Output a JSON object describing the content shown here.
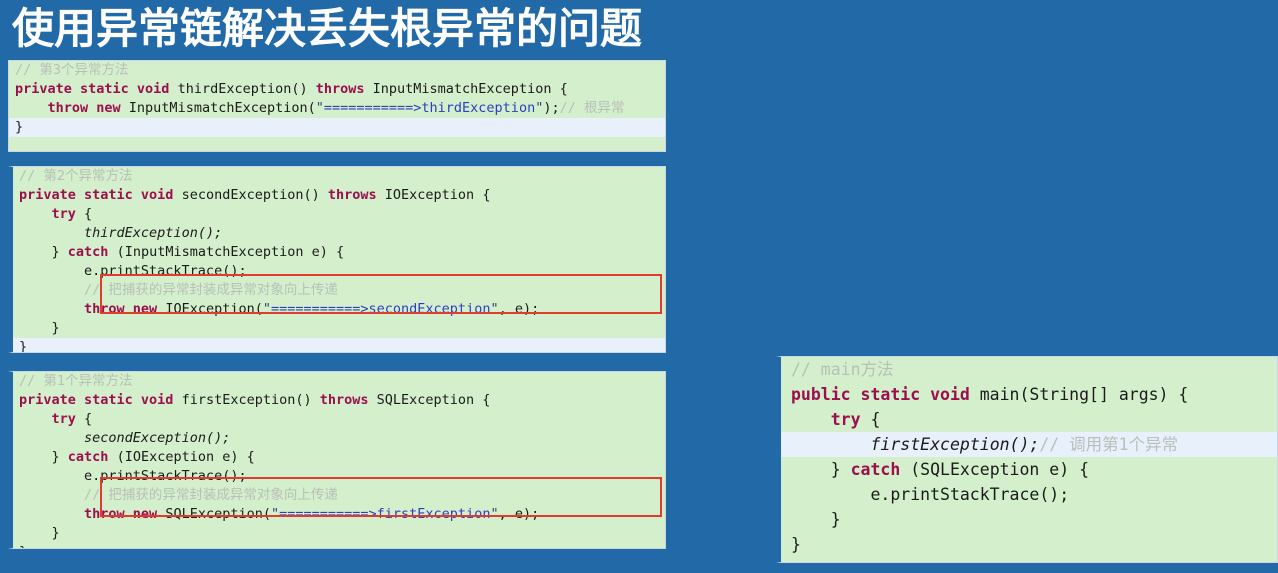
{
  "slide": {
    "title": "使用异常链解决丢失根异常的问题",
    "background_color": "#2269a8",
    "title_color": "#ffffff"
  },
  "theme": {
    "code_background": "#d4efcb",
    "code_border": "#c9d6e8",
    "highlight_line_background": "#e8f0fb",
    "keyword_color": "#9b0f4e",
    "string_color": "#2b3ec4",
    "comment_color": "#b9bfb9",
    "plain_color": "#1b1b1b",
    "red_box_color": "#e03b2c",
    "gutter_color": "#2269a8"
  },
  "code_blocks": {
    "third_exception": {
      "name": "thirdException",
      "lines": [
        {
          "tokens": [
            {
              "t": "// 第3个异常方法",
              "c": "cm"
            }
          ]
        },
        {
          "tokens": [
            {
              "t": "private static void ",
              "c": "kw"
            },
            {
              "t": "thirdException() ",
              "c": "pl"
            },
            {
              "t": "throws ",
              "c": "kw"
            },
            {
              "t": "InputMismatchException {",
              "c": "pl"
            }
          ]
        },
        {
          "tokens": [
            {
              "t": "    ",
              "c": "pl"
            },
            {
              "t": "throw new ",
              "c": "kw"
            },
            {
              "t": "InputMismatchException(",
              "c": "pl"
            },
            {
              "t": "\"",
              "c": "q"
            },
            {
              "t": "===========>thirdException",
              "c": "str"
            },
            {
              "t": "\"",
              "c": "q"
            },
            {
              "t": ");",
              "c": "pl"
            },
            {
              "t": "// 根异常",
              "c": "cm"
            }
          ]
        },
        {
          "hl": true,
          "tokens": [
            {
              "t": "}",
              "c": "pl"
            }
          ]
        }
      ]
    },
    "second_exception": {
      "name": "secondException",
      "lines": [
        {
          "tokens": [
            {
              "t": "// 第2个异常方法",
              "c": "cm"
            }
          ]
        },
        {
          "tokens": [
            {
              "t": "private static void ",
              "c": "kw"
            },
            {
              "t": "secondException() ",
              "c": "pl"
            },
            {
              "t": "throws ",
              "c": "kw"
            },
            {
              "t": "IOException {",
              "c": "pl"
            }
          ]
        },
        {
          "tokens": [
            {
              "t": "    ",
              "c": "pl"
            },
            {
              "t": "try ",
              "c": "kw"
            },
            {
              "t": "{",
              "c": "pl"
            }
          ]
        },
        {
          "tokens": [
            {
              "t": "        ",
              "c": "pl"
            },
            {
              "t": "thirdException();",
              "c": "it"
            }
          ]
        },
        {
          "tokens": [
            {
              "t": "    } ",
              "c": "pl"
            },
            {
              "t": "catch ",
              "c": "kw"
            },
            {
              "t": "(InputMismatchException e) {",
              "c": "pl"
            }
          ]
        },
        {
          "tokens": [
            {
              "t": "        e.printStackTrace();",
              "c": "pl"
            }
          ]
        },
        {
          "tokens": [
            {
              "t": "        ",
              "c": "pl"
            },
            {
              "t": "// 把捕获的异常封装成异常对象向上传递",
              "c": "cm"
            }
          ]
        },
        {
          "tokens": [
            {
              "t": "        ",
              "c": "pl"
            },
            {
              "t": "throw new ",
              "c": "kw"
            },
            {
              "t": "IOException(",
              "c": "pl"
            },
            {
              "t": "\"",
              "c": "q"
            },
            {
              "t": "===========>secondException",
              "c": "str"
            },
            {
              "t": "\"",
              "c": "q"
            },
            {
              "t": ", e);",
              "c": "pl"
            }
          ]
        },
        {
          "tokens": [
            {
              "t": "    }",
              "c": "pl"
            }
          ]
        },
        {
          "hl": true,
          "tokens": [
            {
              "t": "}",
              "c": "pl"
            }
          ]
        }
      ]
    },
    "first_exception": {
      "name": "firstException",
      "lines": [
        {
          "tokens": [
            {
              "t": "// 第1个异常方法",
              "c": "cm"
            }
          ]
        },
        {
          "tokens": [
            {
              "t": "private static void ",
              "c": "kw"
            },
            {
              "t": "firstException() ",
              "c": "pl"
            },
            {
              "t": "throws ",
              "c": "kw"
            },
            {
              "t": "SQLException {",
              "c": "pl"
            }
          ]
        },
        {
          "tokens": [
            {
              "t": "    ",
              "c": "pl"
            },
            {
              "t": "try ",
              "c": "kw"
            },
            {
              "t": "{",
              "c": "pl"
            }
          ]
        },
        {
          "tokens": [
            {
              "t": "        ",
              "c": "pl"
            },
            {
              "t": "secondException();",
              "c": "it"
            }
          ]
        },
        {
          "tokens": [
            {
              "t": "    } ",
              "c": "pl"
            },
            {
              "t": "catch ",
              "c": "kw"
            },
            {
              "t": "(IOException e) {",
              "c": "pl"
            }
          ]
        },
        {
          "tokens": [
            {
              "t": "        e.printStackTrace();",
              "c": "pl"
            }
          ]
        },
        {
          "tokens": [
            {
              "t": "        ",
              "c": "pl"
            },
            {
              "t": "// 把捕获的异常封装成异常对象向上传递",
              "c": "cm"
            }
          ]
        },
        {
          "tokens": [
            {
              "t": "        ",
              "c": "pl"
            },
            {
              "t": "throw new ",
              "c": "kw"
            },
            {
              "t": "SQLException(",
              "c": "pl"
            },
            {
              "t": "\"",
              "c": "q"
            },
            {
              "t": "===========>firstException",
              "c": "str"
            },
            {
              "t": "\"",
              "c": "q"
            },
            {
              "t": ", e);",
              "c": "pl"
            }
          ]
        },
        {
          "tokens": [
            {
              "t": "    }",
              "c": "pl"
            }
          ]
        },
        {
          "tokens": [
            {
              "t": "}",
              "c": "pl"
            }
          ]
        }
      ]
    },
    "main_method": {
      "name": "main",
      "lines": [
        {
          "tokens": [
            {
              "t": "// main方法",
              "c": "cm"
            }
          ]
        },
        {
          "tokens": [
            {
              "t": "public static void ",
              "c": "kw"
            },
            {
              "t": "main(String[] args) {",
              "c": "pl"
            }
          ]
        },
        {
          "tokens": [
            {
              "t": "    ",
              "c": "pl"
            },
            {
              "t": "try ",
              "c": "kw"
            },
            {
              "t": "{",
              "c": "pl"
            }
          ]
        },
        {
          "hl": true,
          "tokens": [
            {
              "t": "        ",
              "c": "pl"
            },
            {
              "t": "firstException();",
              "c": "it"
            },
            {
              "t": "// 调用第1个异常",
              "c": "cm"
            }
          ]
        },
        {
          "tokens": [
            {
              "t": "    } ",
              "c": "pl"
            },
            {
              "t": "catch ",
              "c": "kw"
            },
            {
              "t": "(SQLException e) {",
              "c": "pl"
            }
          ]
        },
        {
          "tokens": [
            {
              "t": "        e.printStackTrace();",
              "c": "pl"
            }
          ]
        },
        {
          "tokens": [
            {
              "t": "    }",
              "c": "pl"
            }
          ]
        },
        {
          "tokens": [
            {
              "t": "}",
              "c": "pl"
            }
          ]
        }
      ]
    }
  },
  "annotations": [
    {
      "id": "redbox-second",
      "target": "second_exception",
      "label": "red-highlight-box"
    },
    {
      "id": "redbox-first",
      "target": "first_exception",
      "label": "red-highlight-box"
    }
  ]
}
